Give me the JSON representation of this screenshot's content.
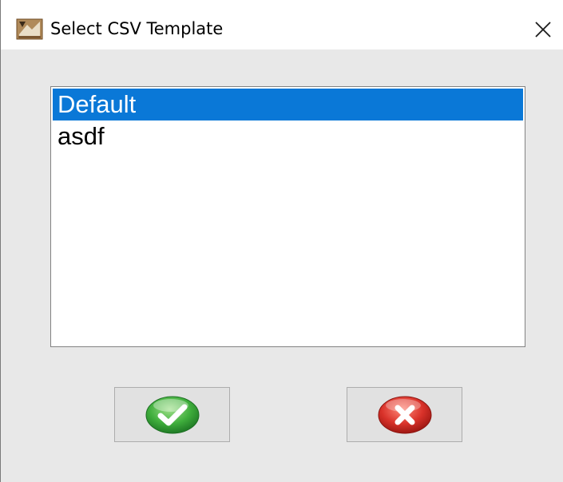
{
  "window": {
    "title": "Select CSV Template",
    "icon": "app-icon",
    "close_icon": "close-icon"
  },
  "list": {
    "items": [
      {
        "label": "Default",
        "selected": true
      },
      {
        "label": "asdf",
        "selected": false
      }
    ]
  },
  "buttons": {
    "ok_icon": "checkmark-icon",
    "cancel_icon": "red-x-icon"
  },
  "colors": {
    "selection": "#0a78d7",
    "ok_green": "#3fae3c",
    "cancel_red": "#d9322a"
  }
}
